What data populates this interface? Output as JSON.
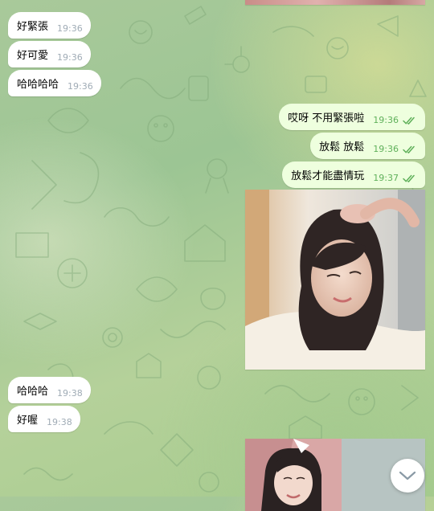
{
  "chat": {
    "messages": [
      {
        "text": "好緊張",
        "time": "19:36"
      },
      {
        "text": "好可愛",
        "time": "19:36"
      },
      {
        "text": "哈哈哈哈",
        "time": "19:36"
      },
      {
        "text": "哎呀  不用緊張啦",
        "time": "19:36"
      },
      {
        "text": "放鬆  放鬆",
        "time": "19:36"
      },
      {
        "text": "放鬆才能盡情玩",
        "time": "19:37"
      },
      {
        "text": "哈哈哈",
        "time": "19:38"
      },
      {
        "text": "好喔",
        "time": "19:38"
      }
    ]
  },
  "icons": {
    "read_receipt": "double-check-icon",
    "scroll_down": "chevron-down-icon"
  },
  "colors": {
    "incoming_bubble": "#ffffff",
    "outgoing_bubble": "#eeffde",
    "read_check": "#5fb05a",
    "timestamp": "#a0acb6"
  }
}
